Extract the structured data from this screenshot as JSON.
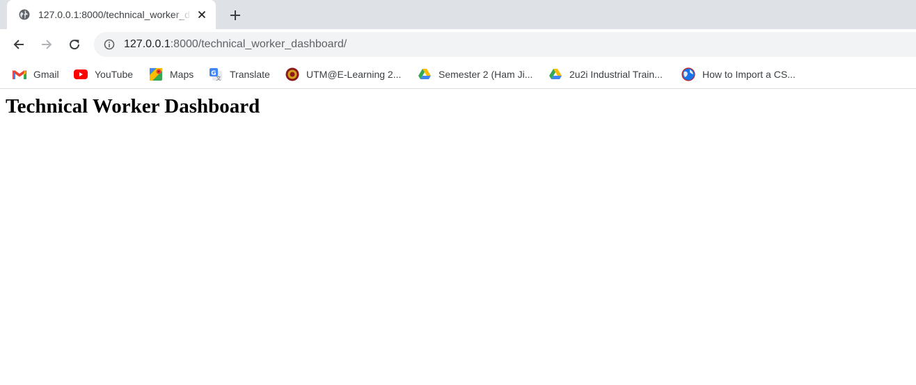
{
  "browser": {
    "tab": {
      "title": "127.0.0.1:8000/technical_worker_dashboard/",
      "favicon": "globe-icon"
    },
    "toolbar": {
      "url_host": "127.0.0.1",
      "url_rest": ":8000/technical_worker_dashboard/"
    },
    "bookmarks": [
      {
        "label": "Gmail",
        "icon": "gmail-icon"
      },
      {
        "label": "YouTube",
        "icon": "youtube-icon"
      },
      {
        "label": "Maps",
        "icon": "maps-icon"
      },
      {
        "label": "Translate",
        "icon": "translate-icon"
      },
      {
        "label": "UTM@E-Learning 2...",
        "icon": "utm-icon"
      },
      {
        "label": "Semester 2 (Ham Ji...",
        "icon": "google-drive-icon"
      },
      {
        "label": "2u2i Industrial Train...",
        "icon": "google-drive-icon"
      },
      {
        "label": "How to Import a CS...",
        "icon": "web-icon"
      }
    ]
  },
  "page": {
    "heading": "Technical Worker Dashboard"
  },
  "colors": {
    "tabstrip": "#dee1e6",
    "omnibox": "#f1f3f4",
    "icon_gray": "#5f6368",
    "youtube_red": "#ff0000",
    "gmail_red": "#ea4335"
  }
}
